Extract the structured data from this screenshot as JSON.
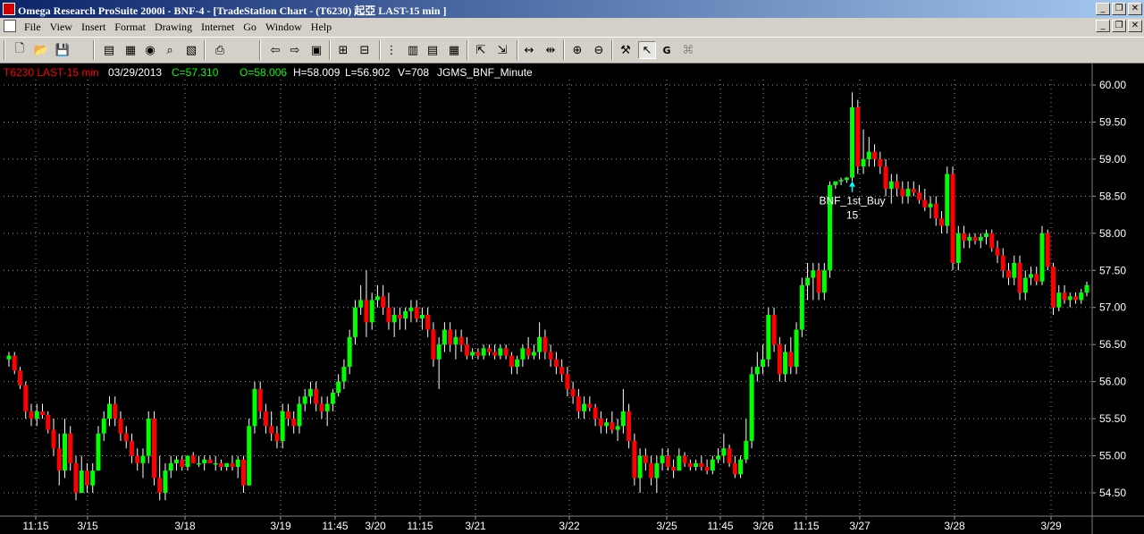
{
  "window": {
    "title": "Omega Research ProSuite 2000i - BNF-4 - [TradeStation Chart - (T6230) 起亞 LAST-15 min ]",
    "controls": [
      "_",
      "❐",
      "✕"
    ]
  },
  "menu": [
    "File",
    "View",
    "Insert",
    "Format",
    "Drawing",
    "Internet",
    "Go",
    "Window",
    "Help"
  ],
  "toolbar": {
    "icons": [
      "new-icon",
      "open-icon",
      "save-icon",
      "chart-window-icon",
      "page-icon",
      "refresh-icon",
      "find-icon",
      "report-icon",
      "print-icon",
      "back-icon",
      "forward-icon",
      "insert-analysis-icon",
      "format-analysis-icon",
      "indicator-icon",
      "data-window-icon",
      "grid-icon",
      "table-icon",
      "bar-chart-icon",
      "expand-icon",
      "space-left-icon",
      "space-right-icon",
      "zoom-in-icon",
      "zoom-out-icon",
      "tools-icon",
      "pointer-icon",
      "global-icon",
      "strategy-icon"
    ]
  },
  "chart_header": {
    "symbol": "T6230 LAST-15 min",
    "date": "03/29/2013",
    "close": "C=57.310",
    "open": "O=58.006",
    "high": "H=58.009",
    "low": "L=56.902",
    "volume": "V=708",
    "strategy": "JGMS_BNF_Minute",
    "symbol_color": "#ff0000",
    "close_color": "#00ff00",
    "open_color": "#00ff00",
    "text_color": "#ffffff"
  },
  "chart_data": {
    "type": "candlestick",
    "title": "T6230 LAST-15 min",
    "ylim": [
      54.3,
      60.2
    ],
    "y_ticks": [
      "60.00",
      "59.50",
      "59.00",
      "58.50",
      "58.00",
      "57.50",
      "57.00",
      "56.50",
      "56.00",
      "55.50",
      "55.00",
      "54.50"
    ],
    "x_ticks": [
      "11:15",
      "3/15",
      "3/18",
      "3/19",
      "11:45",
      "3/20",
      "11:15",
      "3/21",
      "3/22",
      "3/25",
      "11:45",
      "3/26",
      "11:15",
      "3/27",
      "3/28",
      "3/29"
    ],
    "up_color": "#00ff00",
    "down_color": "#ff0000",
    "grid": true,
    "ohlc": [
      [
        56.3,
        56.4,
        56.2,
        56.35
      ],
      [
        56.35,
        56.4,
        56.1,
        56.15
      ],
      [
        56.15,
        56.2,
        55.9,
        55.95
      ],
      [
        55.95,
        56.0,
        55.5,
        55.6
      ],
      [
        55.6,
        55.7,
        55.4,
        55.5
      ],
      [
        55.5,
        55.7,
        55.4,
        55.6
      ],
      [
        55.6,
        55.7,
        55.5,
        55.55
      ],
      [
        55.55,
        55.6,
        55.3,
        55.35
      ],
      [
        55.35,
        55.5,
        55.0,
        55.1
      ],
      [
        55.1,
        55.3,
        54.6,
        54.8
      ],
      [
        54.8,
        55.5,
        54.7,
        55.3
      ],
      [
        55.3,
        55.4,
        54.8,
        54.9
      ],
      [
        54.9,
        55.0,
        54.4,
        54.5
      ],
      [
        54.5,
        55.0,
        54.5,
        54.8
      ],
      [
        54.8,
        54.9,
        54.5,
        54.6
      ],
      [
        54.6,
        54.9,
        54.5,
        54.8
      ],
      [
        54.8,
        55.4,
        54.8,
        55.3
      ],
      [
        55.3,
        55.6,
        55.2,
        55.5
      ],
      [
        55.5,
        55.8,
        55.4,
        55.7
      ],
      [
        55.7,
        55.8,
        55.4,
        55.5
      ],
      [
        55.5,
        55.6,
        55.2,
        55.3
      ],
      [
        55.3,
        55.4,
        55.1,
        55.2
      ],
      [
        55.2,
        55.3,
        54.9,
        55.0
      ],
      [
        55.0,
        55.1,
        54.8,
        54.9
      ],
      [
        54.9,
        55.1,
        54.7,
        55.0
      ],
      [
        55.0,
        55.6,
        54.9,
        55.5
      ],
      [
        55.5,
        55.6,
        54.6,
        54.7
      ],
      [
        54.7,
        55.0,
        54.4,
        54.5
      ],
      [
        54.5,
        54.9,
        54.4,
        54.8
      ],
      [
        54.8,
        55.0,
        54.7,
        54.9
      ],
      [
        54.9,
        55.0,
        54.8,
        54.95
      ],
      [
        54.95,
        55.0,
        54.8,
        54.85
      ],
      [
        54.85,
        55.0,
        54.8,
        55.0
      ],
      [
        55.0,
        55.05,
        54.9,
        54.9
      ],
      [
        54.9,
        55.0,
        54.85,
        54.9
      ],
      [
        54.9,
        55.0,
        54.8,
        54.95
      ],
      [
        54.95,
        55.0,
        54.9,
        54.9
      ],
      [
        54.9,
        55.0,
        54.8,
        54.9
      ],
      [
        54.9,
        54.95,
        54.8,
        54.85
      ],
      [
        54.85,
        54.9,
        54.8,
        54.9
      ],
      [
        54.9,
        55.0,
        54.8,
        54.85
      ],
      [
        54.85,
        55.0,
        54.7,
        54.95
      ],
      [
        54.95,
        55.0,
        54.5,
        54.6
      ],
      [
        54.6,
        55.5,
        54.6,
        55.4
      ],
      [
        55.4,
        56.0,
        55.3,
        55.9
      ],
      [
        55.9,
        56.0,
        55.5,
        55.6
      ],
      [
        55.6,
        55.7,
        55.3,
        55.4
      ],
      [
        55.4,
        55.6,
        55.2,
        55.3
      ],
      [
        55.3,
        55.4,
        55.1,
        55.2
      ],
      [
        55.2,
        55.7,
        55.1,
        55.6
      ],
      [
        55.6,
        55.7,
        55.4,
        55.5
      ],
      [
        55.5,
        55.6,
        55.3,
        55.4
      ],
      [
        55.4,
        55.8,
        55.3,
        55.7
      ],
      [
        55.7,
        55.9,
        55.6,
        55.8
      ],
      [
        55.8,
        56.0,
        55.7,
        55.9
      ],
      [
        55.9,
        56.0,
        55.6,
        55.7
      ],
      [
        55.7,
        55.8,
        55.5,
        55.6
      ],
      [
        55.6,
        55.8,
        55.4,
        55.7
      ],
      [
        55.7,
        55.9,
        55.6,
        55.85
      ],
      [
        55.85,
        56.1,
        55.8,
        56.0
      ],
      [
        56.0,
        56.3,
        55.9,
        56.2
      ],
      [
        56.2,
        56.7,
        56.1,
        56.6
      ],
      [
        56.6,
        57.1,
        56.5,
        57.0
      ],
      [
        57.0,
        57.3,
        56.9,
        57.1
      ],
      [
        57.1,
        57.5,
        56.6,
        56.8
      ],
      [
        56.8,
        57.2,
        56.7,
        57.1
      ],
      [
        57.1,
        57.3,
        57.0,
        57.15
      ],
      [
        57.15,
        57.3,
        56.9,
        57.0
      ],
      [
        57.0,
        57.2,
        56.7,
        56.8
      ],
      [
        56.8,
        57.0,
        56.6,
        56.9
      ],
      [
        56.9,
        57.0,
        56.7,
        56.85
      ],
      [
        56.85,
        57.0,
        56.7,
        56.95
      ],
      [
        56.95,
        57.1,
        56.8,
        57.0
      ],
      [
        57.0,
        57.1,
        56.8,
        56.85
      ],
      [
        56.85,
        57.0,
        56.7,
        56.9
      ],
      [
        56.9,
        57.0,
        56.6,
        56.7
      ],
      [
        56.7,
        56.8,
        56.2,
        56.3
      ],
      [
        56.3,
        56.6,
        55.9,
        56.5
      ],
      [
        56.5,
        56.8,
        56.4,
        56.7
      ],
      [
        56.7,
        56.8,
        56.4,
        56.5
      ],
      [
        56.5,
        56.7,
        56.3,
        56.6
      ],
      [
        56.6,
        56.7,
        56.4,
        56.5
      ],
      [
        56.5,
        56.6,
        56.3,
        56.35
      ],
      [
        56.35,
        56.45,
        56.3,
        56.4
      ],
      [
        56.4,
        56.45,
        56.3,
        56.35
      ],
      [
        56.35,
        56.5,
        56.3,
        56.45
      ],
      [
        56.45,
        56.5,
        56.35,
        56.4
      ],
      [
        56.4,
        56.5,
        56.3,
        56.35
      ],
      [
        56.35,
        56.5,
        56.3,
        56.45
      ],
      [
        56.45,
        56.5,
        56.3,
        56.35
      ],
      [
        56.35,
        56.4,
        56.1,
        56.2
      ],
      [
        56.2,
        56.35,
        56.1,
        56.3
      ],
      [
        56.3,
        56.5,
        56.2,
        56.45
      ],
      [
        56.45,
        56.6,
        56.3,
        56.35
      ],
      [
        56.35,
        56.5,
        56.3,
        56.4
      ],
      [
        56.4,
        56.8,
        56.3,
        56.6
      ],
      [
        56.6,
        56.7,
        56.3,
        56.4
      ],
      [
        56.4,
        56.5,
        56.2,
        56.3
      ],
      [
        56.3,
        56.4,
        56.1,
        56.2
      ],
      [
        56.2,
        56.3,
        56.0,
        56.1
      ],
      [
        56.1,
        56.2,
        55.8,
        55.9
      ],
      [
        55.9,
        56.0,
        55.7,
        55.8
      ],
      [
        55.8,
        55.9,
        55.5,
        55.6
      ],
      [
        55.6,
        55.8,
        55.5,
        55.7
      ],
      [
        55.7,
        55.8,
        55.6,
        55.65
      ],
      [
        55.65,
        55.7,
        55.4,
        55.5
      ],
      [
        55.5,
        55.6,
        55.3,
        55.4
      ],
      [
        55.4,
        55.5,
        55.3,
        55.45
      ],
      [
        55.45,
        55.6,
        55.3,
        55.35
      ],
      [
        55.35,
        55.5,
        55.2,
        55.4
      ],
      [
        55.4,
        55.9,
        55.3,
        55.6
      ],
      [
        55.6,
        55.7,
        55.1,
        55.2
      ],
      [
        55.2,
        55.3,
        54.6,
        54.7
      ],
      [
        54.7,
        55.1,
        54.5,
        55.0
      ],
      [
        55.0,
        55.1,
        54.8,
        54.9
      ],
      [
        54.9,
        55.0,
        54.6,
        54.7
      ],
      [
        54.7,
        55.0,
        54.5,
        54.9
      ],
      [
        54.9,
        55.1,
        54.8,
        55.0
      ],
      [
        55.0,
        55.1,
        54.8,
        54.85
      ],
      [
        54.85,
        54.95,
        54.7,
        54.8
      ],
      [
        54.8,
        55.1,
        54.8,
        55.0
      ],
      [
        55.0,
        55.05,
        54.85,
        54.9
      ],
      [
        54.9,
        54.95,
        54.8,
        54.85
      ],
      [
        54.85,
        54.95,
        54.8,
        54.9
      ],
      [
        54.9,
        55.0,
        54.8,
        54.85
      ],
      [
        54.85,
        54.95,
        54.75,
        54.8
      ],
      [
        54.8,
        55.0,
        54.75,
        54.95
      ],
      [
        54.95,
        55.1,
        54.9,
        55.0
      ],
      [
        55.0,
        55.3,
        54.9,
        55.1
      ],
      [
        55.1,
        55.15,
        54.85,
        54.9
      ],
      [
        54.9,
        55.0,
        54.7,
        54.75
      ],
      [
        54.75,
        55.0,
        54.7,
        54.95
      ],
      [
        54.95,
        55.5,
        54.9,
        55.2
      ],
      [
        55.2,
        56.2,
        55.1,
        56.1
      ],
      [
        56.1,
        56.4,
        56.0,
        56.2
      ],
      [
        56.2,
        56.5,
        56.1,
        56.3
      ],
      [
        56.3,
        57.0,
        56.2,
        56.9
      ],
      [
        56.9,
        57.0,
        56.4,
        56.5
      ],
      [
        56.5,
        56.6,
        56.0,
        56.1
      ],
      [
        56.1,
        56.5,
        56.0,
        56.4
      ],
      [
        56.4,
        56.6,
        56.1,
        56.2
      ],
      [
        56.2,
        56.8,
        56.1,
        56.7
      ],
      [
        56.7,
        57.4,
        56.6,
        57.3
      ],
      [
        57.3,
        57.6,
        57.1,
        57.4
      ],
      [
        57.4,
        57.6,
        57.1,
        57.5
      ],
      [
        57.5,
        57.6,
        57.1,
        57.2
      ],
      [
        57.2,
        57.6,
        57.1,
        57.5
      ],
      [
        57.5,
        58.7,
        57.4,
        58.65
      ],
      [
        58.65,
        58.7,
        58.6,
        58.7
      ],
      [
        58.7,
        58.75,
        58.65,
        58.72
      ],
      [
        58.72,
        58.76,
        58.68,
        58.75
      ],
      [
        58.75,
        59.9,
        58.7,
        59.7
      ],
      [
        59.7,
        59.8,
        58.8,
        58.9
      ],
      [
        58.9,
        59.4,
        58.8,
        59.0
      ],
      [
        59.0,
        59.3,
        58.9,
        59.1
      ],
      [
        59.1,
        59.2,
        58.9,
        59.0
      ],
      [
        59.0,
        59.1,
        58.8,
        58.9
      ],
      [
        58.9,
        59.0,
        58.5,
        58.6
      ],
      [
        58.6,
        58.8,
        58.4,
        58.7
      ],
      [
        58.7,
        58.8,
        58.5,
        58.6
      ],
      [
        58.6,
        58.7,
        58.4,
        58.5
      ],
      [
        58.5,
        58.7,
        58.4,
        58.6
      ],
      [
        58.6,
        58.7,
        58.5,
        58.55
      ],
      [
        58.55,
        58.65,
        58.4,
        58.45
      ],
      [
        58.45,
        58.6,
        58.3,
        58.35
      ],
      [
        58.35,
        58.5,
        58.2,
        58.4
      ],
      [
        58.4,
        58.5,
        58.1,
        58.2
      ],
      [
        58.2,
        58.3,
        58.0,
        58.1
      ],
      [
        58.1,
        58.9,
        58.0,
        58.8
      ],
      [
        58.8,
        58.9,
        57.5,
        57.6
      ],
      [
        57.6,
        58.1,
        57.5,
        58.0
      ],
      [
        58.0,
        58.1,
        57.8,
        57.9
      ],
      [
        57.9,
        58.0,
        57.8,
        57.95
      ],
      [
        57.95,
        58.0,
        57.85,
        57.9
      ],
      [
        57.9,
        58.0,
        57.8,
        57.95
      ],
      [
        57.95,
        58.05,
        57.85,
        58.0
      ],
      [
        58.0,
        58.05,
        57.75,
        57.8
      ],
      [
        57.8,
        57.9,
        57.6,
        57.7
      ],
      [
        57.7,
        57.8,
        57.4,
        57.5
      ],
      [
        57.5,
        57.6,
        57.3,
        57.4
      ],
      [
        57.4,
        57.7,
        57.3,
        57.6
      ],
      [
        57.6,
        57.7,
        57.1,
        57.2
      ],
      [
        57.2,
        57.5,
        57.1,
        57.4
      ],
      [
        57.4,
        57.55,
        57.3,
        57.45
      ],
      [
        57.45,
        57.55,
        57.3,
        57.35
      ],
      [
        57.35,
        58.1,
        57.3,
        58.0
      ],
      [
        58.0,
        58.05,
        57.5,
        57.55
      ],
      [
        57.55,
        57.6,
        56.9,
        57.0
      ],
      [
        57.0,
        57.3,
        56.95,
        57.2
      ],
      [
        57.2,
        57.3,
        57.05,
        57.1
      ],
      [
        57.1,
        57.2,
        57.0,
        57.15
      ],
      [
        57.15,
        57.2,
        57.05,
        57.1
      ],
      [
        57.1,
        57.25,
        57.05,
        57.2
      ],
      [
        57.2,
        57.35,
        57.15,
        57.3
      ]
    ],
    "annotation": {
      "label": "BNF_1st_Buy",
      "sub": "15",
      "price": 58.75,
      "bar": 151
    }
  }
}
